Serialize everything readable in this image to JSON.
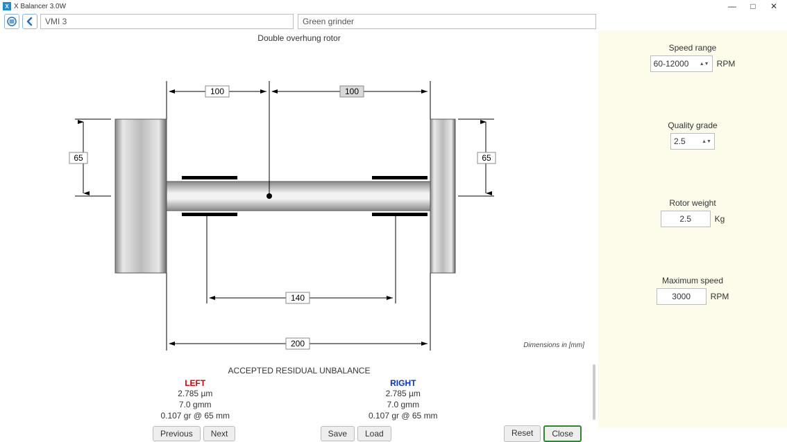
{
  "window": {
    "title": "X Balancer 3.0W"
  },
  "toolbar": {
    "field_left": "VMI 3",
    "field_right": "Green grinder"
  },
  "diagram": {
    "title": "Double overhung rotor",
    "dims": {
      "top_left": "100",
      "top_right": "100",
      "side_left": "65",
      "side_right": "65",
      "mid": "140",
      "bottom": "200"
    },
    "note": "Dimensions in [mm]"
  },
  "params": {
    "speed_range": {
      "label": "Speed range",
      "value": "60-12000",
      "unit": "RPM"
    },
    "quality_grade": {
      "label": "Quality grade",
      "value": "2.5"
    },
    "rotor_weight": {
      "label": "Rotor weight",
      "value": "2.5",
      "unit": "Kg"
    },
    "max_speed": {
      "label": "Maximum speed",
      "value": "3000",
      "unit": "RPM"
    }
  },
  "residual": {
    "title": "ACCEPTED RESIDUAL UNBALANCE",
    "left": {
      "head": "LEFT",
      "v1": "2.785 µm",
      "v2": "7.0 gmm",
      "v3": "0.107 gr @ 65 mm"
    },
    "right": {
      "head": "RIGHT",
      "v1": "2.785 µm",
      "v2": "7.0 gmm",
      "v3": "0.107 gr @ 65 mm"
    }
  },
  "buttons": {
    "previous": "Previous",
    "next": "Next",
    "save": "Save",
    "load": "Load",
    "reset": "Reset",
    "close": "Close"
  }
}
